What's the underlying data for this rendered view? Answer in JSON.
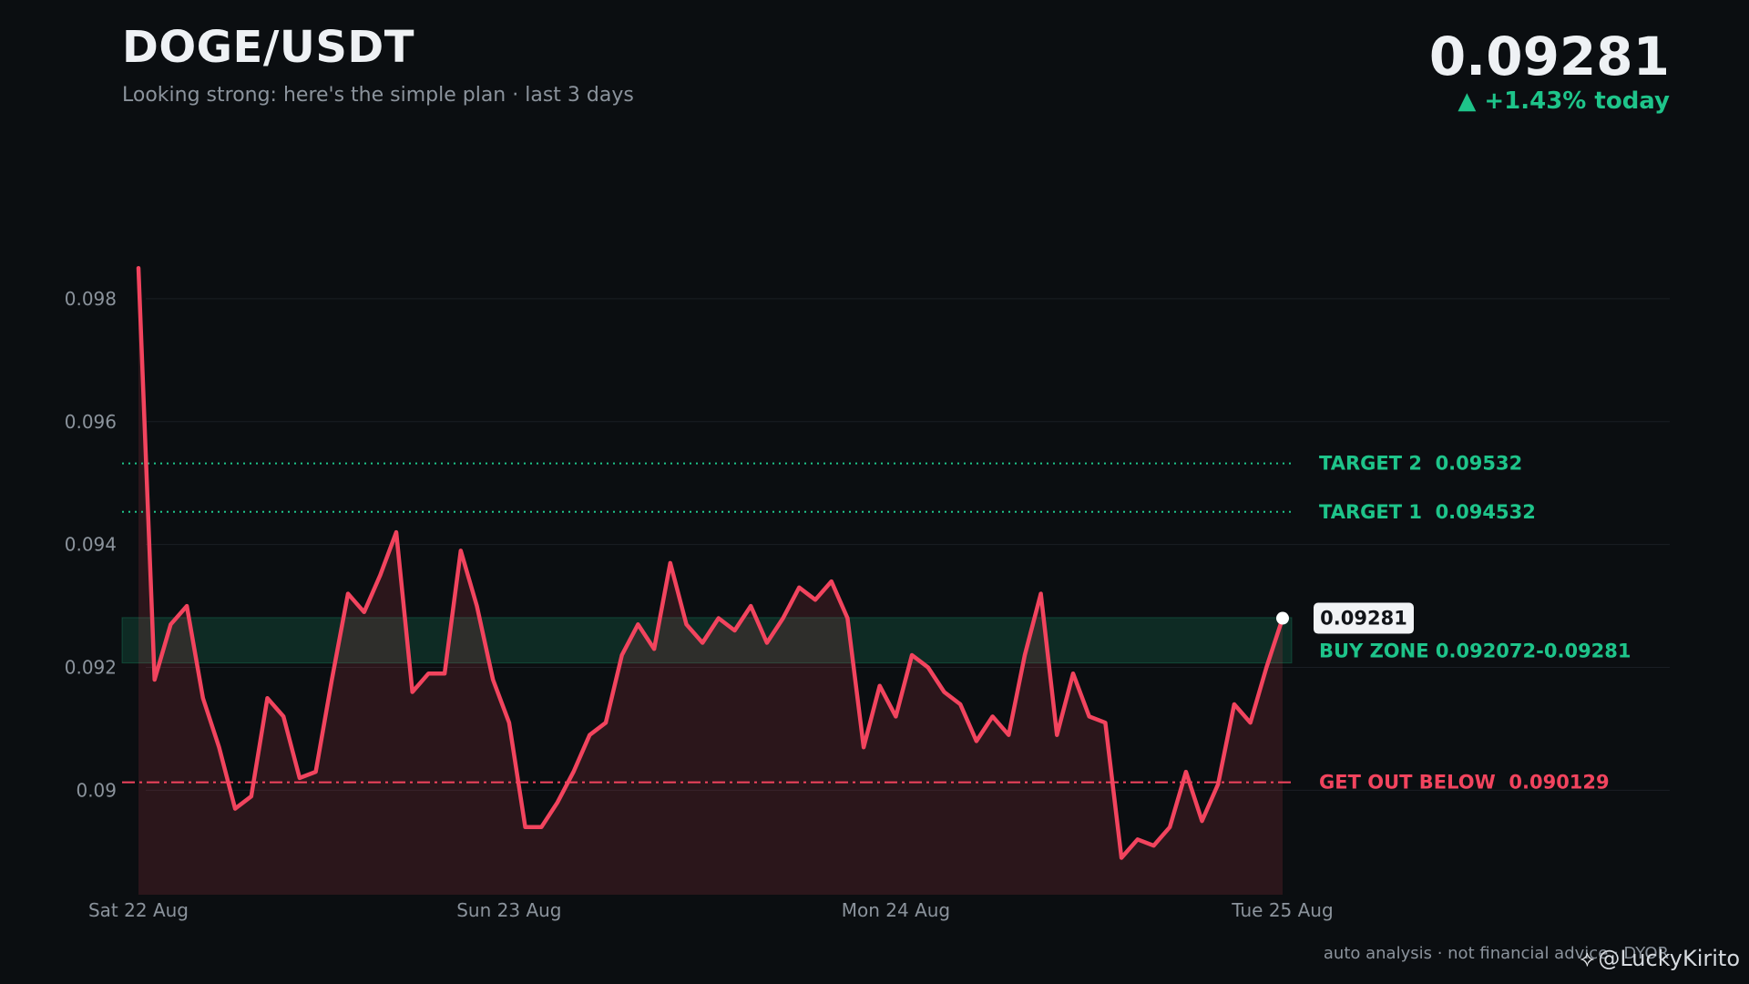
{
  "header": {
    "title": "DOGE/USDT",
    "subtitle": "Looking strong: here's the simple plan · last 3 days",
    "price": "0.09281",
    "change": "▲ +1.43% today"
  },
  "footer": {
    "disclaimer": "auto analysis · not financial advice · DYOR",
    "watermark": "@LuckyKirito",
    "watermark_icon": "binance-logo-icon"
  },
  "colors": {
    "background": "#0b0e11",
    "line": "#f2445e",
    "green": "#1ec48a",
    "red": "#f2445e",
    "grid": "#1a1e24",
    "tick": "#8b939c"
  },
  "chart_data": {
    "type": "line",
    "title": "DOGE/USDT",
    "ylim": [
      0.0883,
      0.0996
    ],
    "y_ticks": [
      "0.098",
      "0.096",
      "0.094",
      "0.092",
      "0.09"
    ],
    "y_tick_values": [
      0.098,
      0.096,
      0.094,
      0.092,
      0.09
    ],
    "x_ticks": [
      "Sat 22 Aug",
      "Sun 23 Aug",
      "Mon 24 Aug",
      "Tue 25 Aug"
    ],
    "x_tick_index": [
      0,
      23,
      47,
      71
    ],
    "grid": true,
    "series": [
      {
        "values": [
          0.0985,
          0.0918,
          0.0927,
          0.093,
          0.0915,
          0.0907,
          0.0897,
          0.0899,
          0.0915,
          0.0912,
          0.0902,
          0.0903,
          0.0918,
          0.0932,
          0.0929,
          0.0935,
          0.0942,
          0.0916,
          0.0919,
          0.0919,
          0.0939,
          0.093,
          0.0918,
          0.0911,
          0.0894,
          0.0894,
          0.0898,
          0.0903,
          0.0909,
          0.0911,
          0.0922,
          0.0927,
          0.0923,
          0.0937,
          0.0927,
          0.0924,
          0.0928,
          0.0926,
          0.093,
          0.0924,
          0.0928,
          0.0933,
          0.0931,
          0.0934,
          0.0928,
          0.0907,
          0.0917,
          0.0912,
          0.0922,
          0.092,
          0.0916,
          0.0914,
          0.0908,
          0.0912,
          0.0909,
          0.0922,
          0.0932,
          0.0909,
          0.0919,
          0.0912,
          0.0911,
          0.0889,
          0.0892,
          0.0891,
          0.0894,
          0.0903,
          0.0895,
          0.0901,
          0.0914,
          0.0911,
          0.092,
          0.0928
        ]
      }
    ],
    "last_label": "0.09281",
    "levels": [
      {
        "label": "TARGET 2  0.09532",
        "value": 0.09532,
        "style": "dotted",
        "color": "#1ec48a"
      },
      {
        "label": "TARGET 1  0.094532",
        "value": 0.094532,
        "style": "dotted",
        "color": "#1ec48a"
      },
      {
        "label": "GET OUT BELOW  0.090129",
        "value": 0.090129,
        "style": "dashdot",
        "color": "#f2445e"
      }
    ],
    "buy_zone": {
      "label": "BUY ZONE 0.092072-0.09281",
      "low": 0.092072,
      "high": 0.09281,
      "color": "#1ec48a"
    }
  }
}
